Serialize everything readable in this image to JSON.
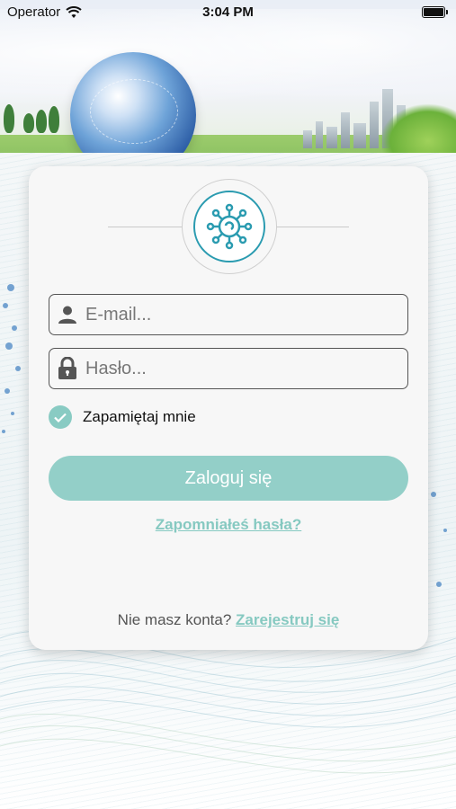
{
  "status_bar": {
    "carrier": "Operator",
    "time": "3:04 PM",
    "wifi_icon": "wifi-icon",
    "battery_icon": "battery-icon"
  },
  "login": {
    "logo_icon": "virus-molecule-logo-icon",
    "email": {
      "placeholder": "E-mail...",
      "value": "",
      "icon": "user-icon"
    },
    "password": {
      "placeholder": "Hasło...",
      "value": "",
      "icon": "lock-icon"
    },
    "remember": {
      "label": "Zapamiętaj mnie",
      "checked": true
    },
    "login_button": "Zaloguj się",
    "forgot_link": "Zapomniałeś hasła?",
    "register_prompt": "Nie masz konta?",
    "register_link": "Zarejestruj się"
  },
  "colors": {
    "accent": "#86c9c1",
    "button": "#93cfc8",
    "logo_blue": "#2a9bb0"
  }
}
